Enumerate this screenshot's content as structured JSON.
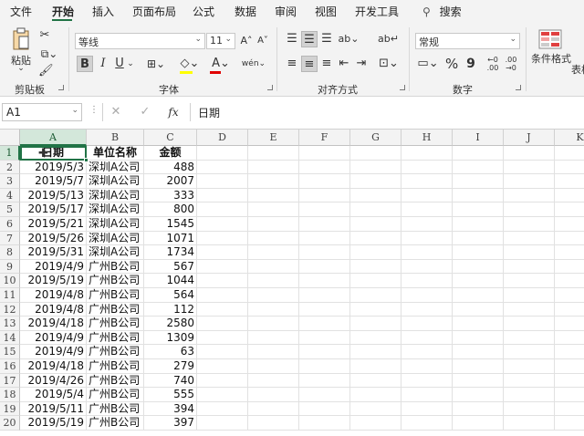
{
  "tabs": [
    "文件",
    "开始",
    "插入",
    "页面布局",
    "公式",
    "数据",
    "审阅",
    "视图",
    "开发工具"
  ],
  "tabs_active": "开始",
  "search_label": "搜索",
  "ribbon": {
    "clipboard": {
      "label": "剪贴板",
      "paste": "粘贴"
    },
    "font": {
      "label": "字体",
      "font_name": "等线",
      "font_size": "11",
      "bold": "B",
      "italic": "I",
      "underline": "U",
      "font_color": "#e00000",
      "fill_color": "#ffff00"
    },
    "alignment": {
      "label": "对齐方式"
    },
    "number": {
      "label": "数字",
      "format": "常规",
      "percent": "%",
      "comma": "9",
      "inc_decimal": "←0 .00",
      "dec_decimal": ".00 →0"
    },
    "styles": {
      "conditional": "条件格式",
      "table": "表格"
    }
  },
  "formula_bar": {
    "name_box": "A1",
    "fx": "fx",
    "content": "日期"
  },
  "columns": [
    "A",
    "B",
    "C",
    "D",
    "E",
    "F",
    "G",
    "H",
    "I",
    "J",
    "K"
  ],
  "selected_column": "A",
  "selected_row": 1,
  "header_row": [
    "日期",
    "单位名称",
    "金额"
  ],
  "rows": [
    [
      "2019/5/3",
      "深圳A公司",
      "488"
    ],
    [
      "2019/5/7",
      "深圳A公司",
      "2007"
    ],
    [
      "2019/5/13",
      "深圳A公司",
      "333"
    ],
    [
      "2019/5/17",
      "深圳A公司",
      "800"
    ],
    [
      "2019/5/21",
      "深圳A公司",
      "1545"
    ],
    [
      "2019/5/26",
      "深圳A公司",
      "1071"
    ],
    [
      "2019/5/31",
      "深圳A公司",
      "1734"
    ],
    [
      "2019/4/9",
      "广州B公司",
      "567"
    ],
    [
      "2019/5/19",
      "广州B公司",
      "1044"
    ],
    [
      "2019/4/8",
      "广州B公司",
      "564"
    ],
    [
      "2019/4/8",
      "广州B公司",
      "112"
    ],
    [
      "2019/4/18",
      "广州B公司",
      "2580"
    ],
    [
      "2019/4/9",
      "广州B公司",
      "1309"
    ],
    [
      "2019/4/9",
      "广州B公司",
      "63"
    ],
    [
      "2019/4/18",
      "广州B公司",
      "279"
    ],
    [
      "2019/4/26",
      "广州B公司",
      "740"
    ],
    [
      "2019/5/4",
      "广州B公司",
      "555"
    ],
    [
      "2019/5/11",
      "广州B公司",
      "394"
    ],
    [
      "2019/5/19",
      "广州B公司",
      "397"
    ]
  ],
  "row_numbers": [
    "1",
    "2",
    "3",
    "4",
    "5",
    "6",
    "7",
    "8",
    "9",
    "10",
    "11",
    "12",
    "13",
    "14",
    "15",
    "16",
    "17",
    "18",
    "19",
    "20"
  ],
  "accent_color": "#217346"
}
